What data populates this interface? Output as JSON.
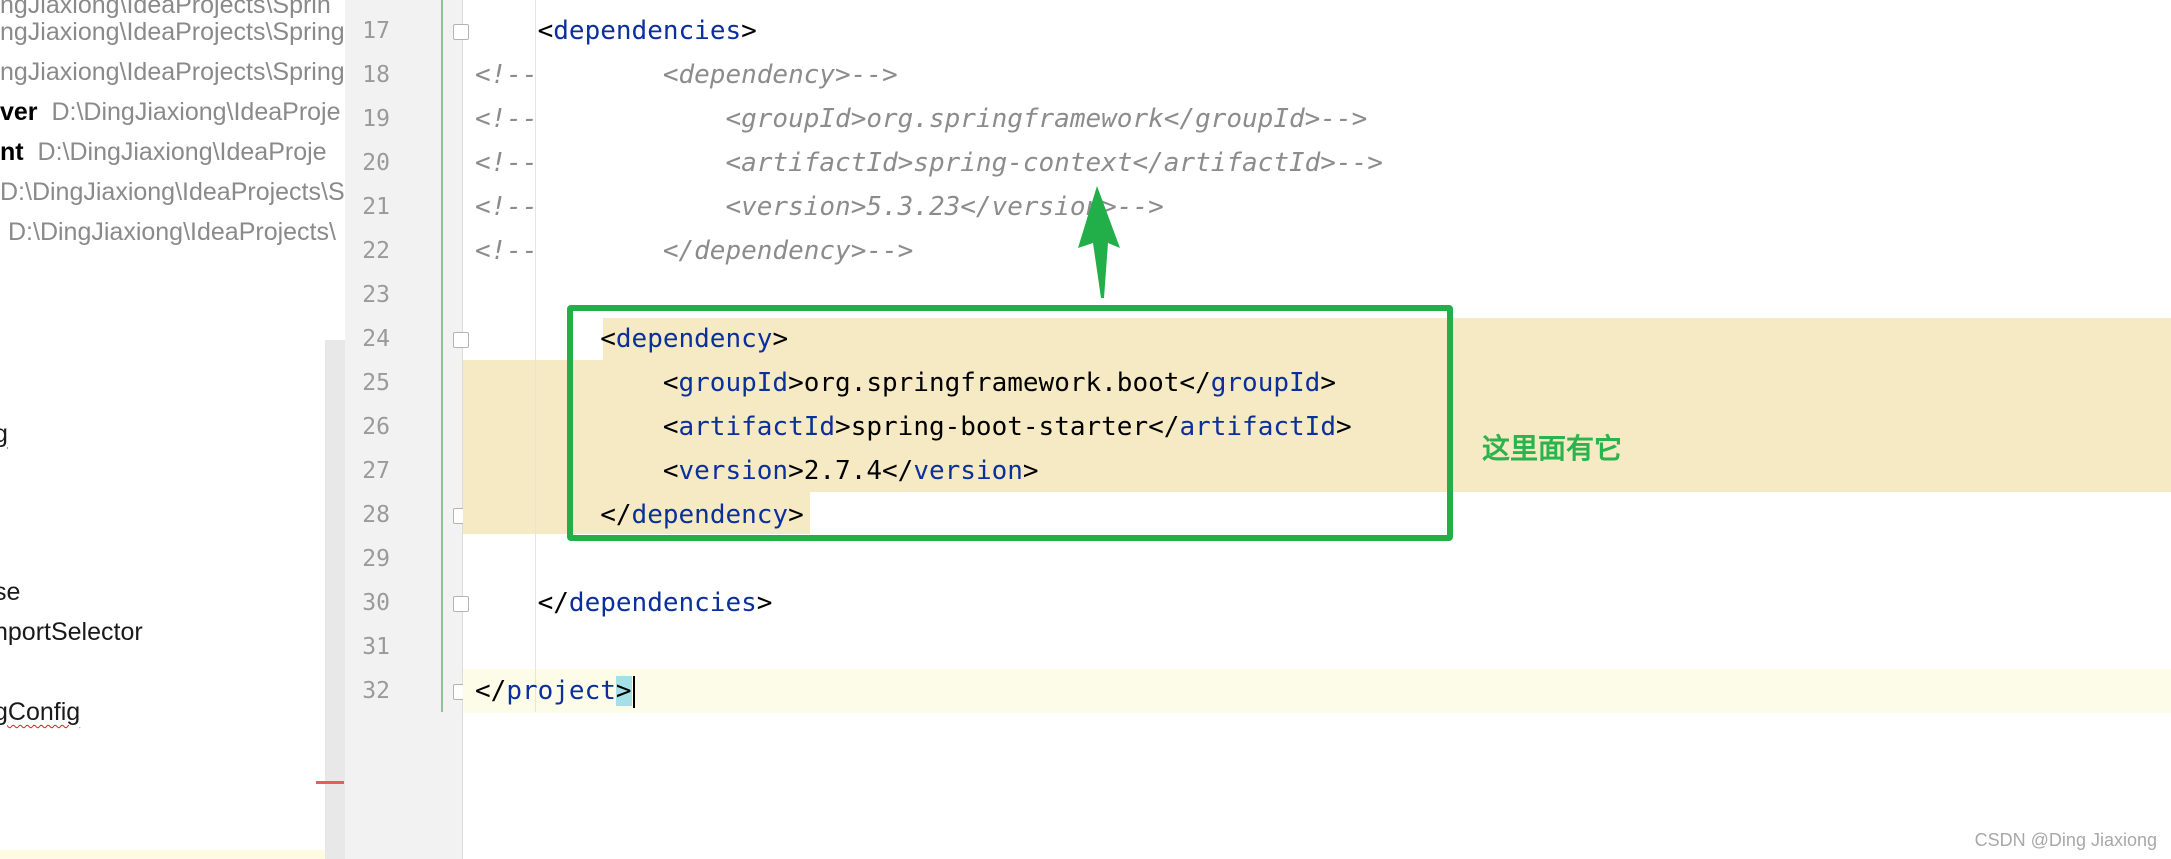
{
  "sidebar": {
    "rows": [
      {
        "name": "",
        "path": "ngJiaxiong\\IdeaProjects\\Sprin",
        "text": ""
      },
      {
        "name": "",
        "path": "ngJiaxiong\\IdeaProjects\\Spring",
        "text": ""
      },
      {
        "name": "",
        "path": "ngJiaxiong\\IdeaProjects\\Spring",
        "text": ""
      },
      {
        "name": "ver",
        "path": "D:\\DingJiaxiong\\IdeaProje",
        "text": ""
      },
      {
        "name": "nt",
        "path": "D:\\DingJiaxiong\\IdeaProje",
        "text": ""
      },
      {
        "name": "",
        "path": "D:\\DingJiaxiong\\IdeaProjects\\S",
        "text": ""
      },
      {
        "name": "",
        "path": "D:\\DingJiaxiong\\IdeaProjects\\",
        "text": ""
      },
      {
        "name": "",
        "path": "",
        "text": "g"
      },
      {
        "name": "",
        "path": "",
        "text": "se"
      },
      {
        "name": "",
        "path": "",
        "text": "nportSelector"
      },
      {
        "name": "",
        "path": "",
        "text": "gConfig"
      }
    ]
  },
  "editor": {
    "line_numbers": [
      "17",
      "18",
      "19",
      "20",
      "21",
      "22",
      "23",
      "24",
      "25",
      "26",
      "27",
      "28",
      "29",
      "30",
      "31",
      "32"
    ],
    "code": {
      "l17": {
        "open": "<",
        "tag": "dependencies",
        "close": ">"
      },
      "l18": {
        "prefix": "<!--",
        "body": "        <dependency>-->"
      },
      "l19": {
        "prefix": "<!--",
        "body": "            <groupId>org.springframework</groupId>-->"
      },
      "l20": {
        "prefix": "<!--",
        "body": "            <artifactId>spring-context</artifactId>-->"
      },
      "l21": {
        "prefix": "<!--",
        "body": "            <version>5.3.23</version>-->"
      },
      "l22": {
        "prefix": "<!--",
        "body": "        </dependency>-->"
      },
      "l24": {
        "tag": "dependency"
      },
      "l25": {
        "tag": "groupId",
        "value": "org.springframework.boot"
      },
      "l26": {
        "tag": "artifactId",
        "value": "spring-boot-starter"
      },
      "l27": {
        "tag": "version",
        "value": "2.7.4"
      },
      "l28": {
        "tag": "dependency"
      },
      "l30": {
        "tag": "dependencies"
      },
      "l32": {
        "tag": "project"
      }
    }
  },
  "annotation": {
    "text": "这里面有它",
    "color": "#22ae49"
  },
  "watermark": "CSDN @Ding Jiaxiong",
  "colors": {
    "tag": "#0b2f9c",
    "comment": "#8c8c8c",
    "highlight": "#f5eac3",
    "gutter": "#f2f2f2"
  }
}
